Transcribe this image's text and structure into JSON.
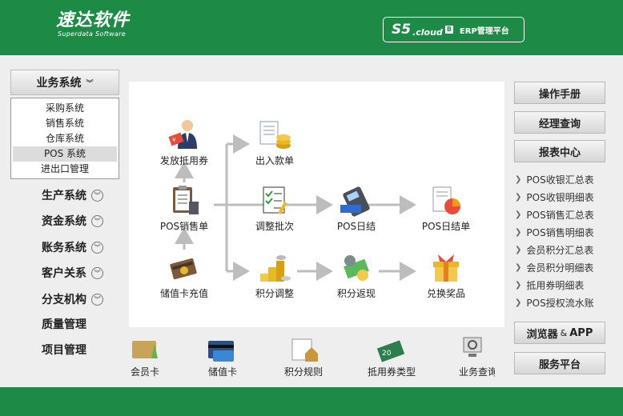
{
  "header": {
    "logo_cn": "速达软件",
    "logo_en": "Superdata Software",
    "platform_s5": "S5",
    "platform_cloud": ".cloud",
    "platform_box": "B",
    "platform_erp": "ERP管理平台"
  },
  "left_menu": {
    "head_label": "业务系统",
    "sub_items": [
      "采购系统",
      "销售系统",
      "仓库系统",
      "POS 系统",
      "进出口管理"
    ],
    "active_sub_index": 3,
    "items": [
      {
        "label": "生产系统",
        "expandable": true
      },
      {
        "label": "资金系统",
        "expandable": true
      },
      {
        "label": "账务系统",
        "expandable": true
      },
      {
        "label": "客户关系",
        "expandable": true
      },
      {
        "label": "分支机构",
        "expandable": true
      },
      {
        "label": "质量管理",
        "expandable": false
      },
      {
        "label": "项目管理",
        "expandable": false
      }
    ]
  },
  "flow": {
    "issue_coupon": "发放抵用券",
    "in_out_slip": "出入款单",
    "pos_sales_slip": "POS销售单",
    "adjust_batch": "调整批次",
    "pos_daily_close": "POS日结",
    "pos_daily_close_slip": "POS日结单",
    "stored_card_recharge": "储值卡充值",
    "points_adjust": "积分调整",
    "points_cashback": "积分返现",
    "redeem_prize": "兑换奖品"
  },
  "quick_links": [
    "会员卡",
    "储值卡",
    "积分规则",
    "抵用券类型",
    "业务查询"
  ],
  "right_panel": {
    "manual": "操作手册",
    "manager_query": "经理查询",
    "report_center": "报表中心",
    "reports": [
      "POS收银汇总表",
      "POS收银明细表",
      "POS销售汇总表",
      "POS销售明细表",
      "会员积分汇总表",
      "会员积分明细表",
      "抵用券明细表",
      "POS授权流水账"
    ],
    "browser_app": {
      "part1": "浏览器",
      "amp": "&",
      "part2": "APP"
    },
    "service_platform": "服务平台"
  },
  "colors": {
    "brand_green": "#1d8a45",
    "arrow_gray": "#bdbdbd"
  }
}
